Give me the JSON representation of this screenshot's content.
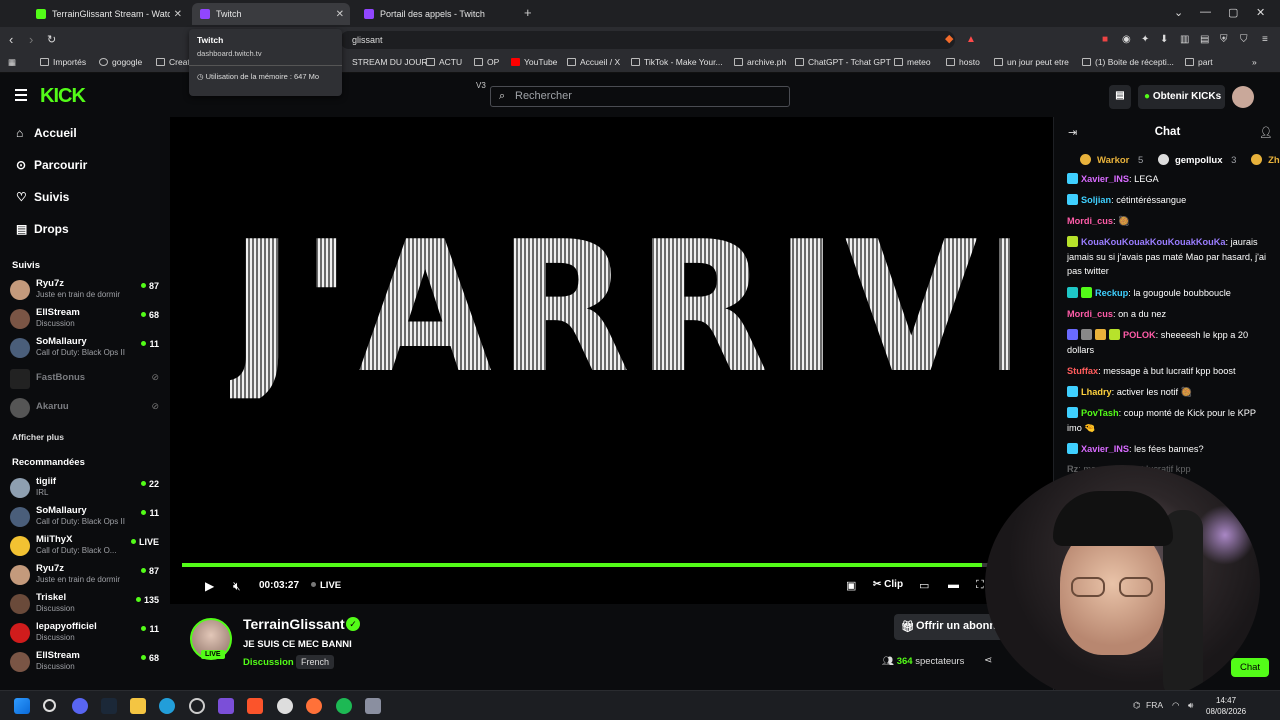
{
  "browser": {
    "tabs": [
      {
        "label": "TerrainGlissant Stream - Watch L",
        "color": "#53fc18"
      },
      {
        "label": "Twitch",
        "color": "#9146ff"
      },
      {
        "label": "Portail des appels - Twitch",
        "color": "#9146ff"
      }
    ],
    "url_fragment": "glissant",
    "tooltip": {
      "title": "Twitch",
      "url": "dashboard.twitch.tv",
      "memory": "Utilisation de la mémoire : 647 Mo"
    },
    "bookmarks": [
      "Importés",
      "gogogle",
      "Creat",
      "STREAM DU JOUR",
      "ACTU",
      "OP",
      "YouTube",
      "Accueil / X",
      "TikTok - Make Your...",
      "archive.ph",
      "ChatGPT - Tchat GPT",
      "meteo",
      "hosto",
      "un jour peut etre",
      "(1) Boite de récepti...",
      "part"
    ]
  },
  "header": {
    "logo": "KICK",
    "search_placeholder": "Rechercher",
    "get_kicks": "Obtenir KICKs"
  },
  "sidebar": {
    "nav": [
      {
        "label": "Accueil",
        "icon": "home-icon"
      },
      {
        "label": "Parcourir",
        "icon": "browse-icon"
      },
      {
        "label": "Suivis",
        "icon": "heart-icon"
      },
      {
        "label": "Drops",
        "icon": "drops-icon"
      }
    ],
    "followed_title": "Suivis",
    "followed": [
      {
        "name": "Ryu7z",
        "game": "Juste en train de dormir",
        "viewers": "87"
      },
      {
        "name": "EllStream",
        "game": "Discussion",
        "viewers": "68"
      },
      {
        "name": "SoMallaury",
        "game": "Call of Duty: Black Ops II",
        "viewers": "11"
      },
      {
        "name": "FastBonus",
        "game": "",
        "viewers": ""
      },
      {
        "name": "Akaruu",
        "game": "",
        "viewers": ""
      }
    ],
    "show_more": "Afficher plus",
    "recommended_title": "Recommandées",
    "recommended": [
      {
        "name": "tigiif",
        "game": "IRL",
        "viewers": "22"
      },
      {
        "name": "SoMallaury",
        "game": "Call of Duty: Black Ops II",
        "viewers": "11"
      },
      {
        "name": "MiiThyX",
        "game": "Call of Duty: Black O...",
        "viewers": "LIVE"
      },
      {
        "name": "Ryu7z",
        "game": "Juste en train de dormir",
        "viewers": "87"
      },
      {
        "name": "Triskel",
        "game": "Discussion",
        "viewers": "135"
      },
      {
        "name": "lepapyofficiel",
        "game": "Discussion",
        "viewers": "11"
      },
      {
        "name": "EllStream",
        "game": "Discussion",
        "viewers": "68"
      }
    ]
  },
  "player": {
    "overlay_text": "J'ARRIVE",
    "time": "00:03:27",
    "live_label": "LIVE",
    "clip_label": "Clip",
    "progress": 0.93
  },
  "stream": {
    "streamer": "TerrainGlissant",
    "live_badge": "LIVE",
    "title": "JE SUIS CE MEC BANNI",
    "category": "Discussion",
    "language": "French",
    "offer_button": "Offrir un abonnement",
    "viewers_count": "364",
    "viewers_label": "spectateurs"
  },
  "chat": {
    "title": "Chat",
    "gifters": [
      {
        "name": "Warkor",
        "count": "5",
        "color": "#e8b23b"
      },
      {
        "name": "gempollux",
        "count": "3",
        "color": "#fff"
      },
      {
        "name": "Zhuli",
        "count": "",
        "color": "#e8b23b"
      }
    ],
    "messages": [
      {
        "user": "Xavier_INS",
        "color": "#d86bff",
        "text": "LEGA"
      },
      {
        "user": "Soljian",
        "color": "#3fd0ff",
        "text": "cétintéréssangue"
      },
      {
        "user": "Mordi_cus",
        "color": "#ff5ca8",
        "text": "🥘"
      },
      {
        "user": "KouaKouKouakKouKouakKouKa",
        "color": "#9a7dff",
        "text": "jaurais jamais su si j'avais pas maté Mao par hasard, j'ai pas twitter"
      },
      {
        "user": "Reckup",
        "color": "#3fd0ff",
        "text": "la gougoule boubboucle"
      },
      {
        "user": "Mordi_cus",
        "color": "#ff5ca8",
        "text": "on a du nez"
      },
      {
        "user": "POLOK",
        "color": "#ff5ca8",
        "text": "sheeeesh le kpp a 20 dollars"
      },
      {
        "user": "Stuffax",
        "color": "#ff5c5c",
        "text": "message à but lucratif kpp boost"
      },
      {
        "user": "Lhadry",
        "color": "#ffd23f",
        "text": "activer les notif 🥘"
      },
      {
        "user": "PovTash",
        "color": "#53fc18",
        "text": "coup monté de Kick pour le KPP imo 🤏"
      },
      {
        "user": "Xavier_INS",
        "color": "#d86bff",
        "text": "les fées bannes?"
      },
      {
        "user": "Rz",
        "color": "#888",
        "text": "message à but lucratif kpp"
      }
    ],
    "chat_button": "Chat"
  },
  "taskbar": {
    "time": "14:47",
    "date": "08/08/2026",
    "lang": "FRA"
  }
}
